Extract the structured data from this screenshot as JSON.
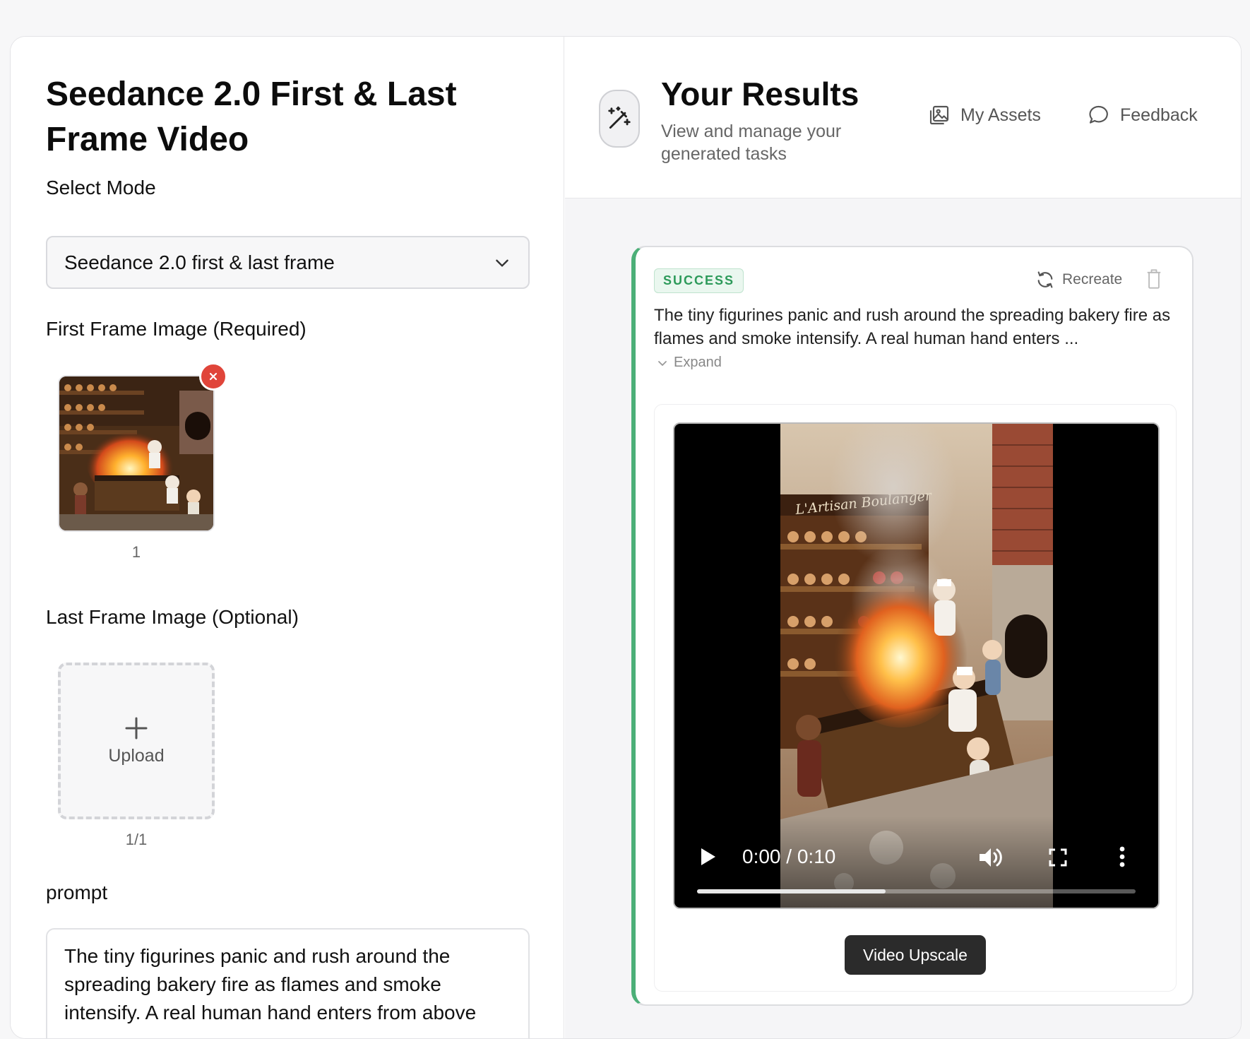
{
  "left": {
    "title": "Seedance 2.0 First & Last Frame Video",
    "select_mode_label": "Select Mode",
    "select_mode_value": "Seedance 2.0 first & last frame",
    "first_frame_label": "First Frame Image (Required)",
    "first_frame_count": "1",
    "last_frame_label": "Last Frame Image (Optional)",
    "upload_label": "Upload",
    "upload_count": "1/1",
    "prompt_label": "prompt",
    "prompt_text": "The tiny figurines panic and rush around the spreading bakery fire as flames and smoke intensify. A real human hand enters from above"
  },
  "right": {
    "title": "Your Results",
    "subtitle": "View and manage your generated tasks",
    "my_assets": "My Assets",
    "feedback": "Feedback",
    "card": {
      "status": "SUCCESS",
      "status_color": "#2d9a5a",
      "accent_color": "#4caf78",
      "recreate_label": "Recreate",
      "prompt_preview": "The tiny figurines panic and rush around the spreading bakery fire as flames and smoke intensify. A real human hand enters ...",
      "expand_label": "Expand",
      "video": {
        "current_time": "0:00",
        "separator": "/",
        "duration": "0:10",
        "shop_sign": "L'Artisan Boulanger",
        "buffered_fraction": 0.43
      },
      "upscale_label": "Video Upscale"
    }
  }
}
